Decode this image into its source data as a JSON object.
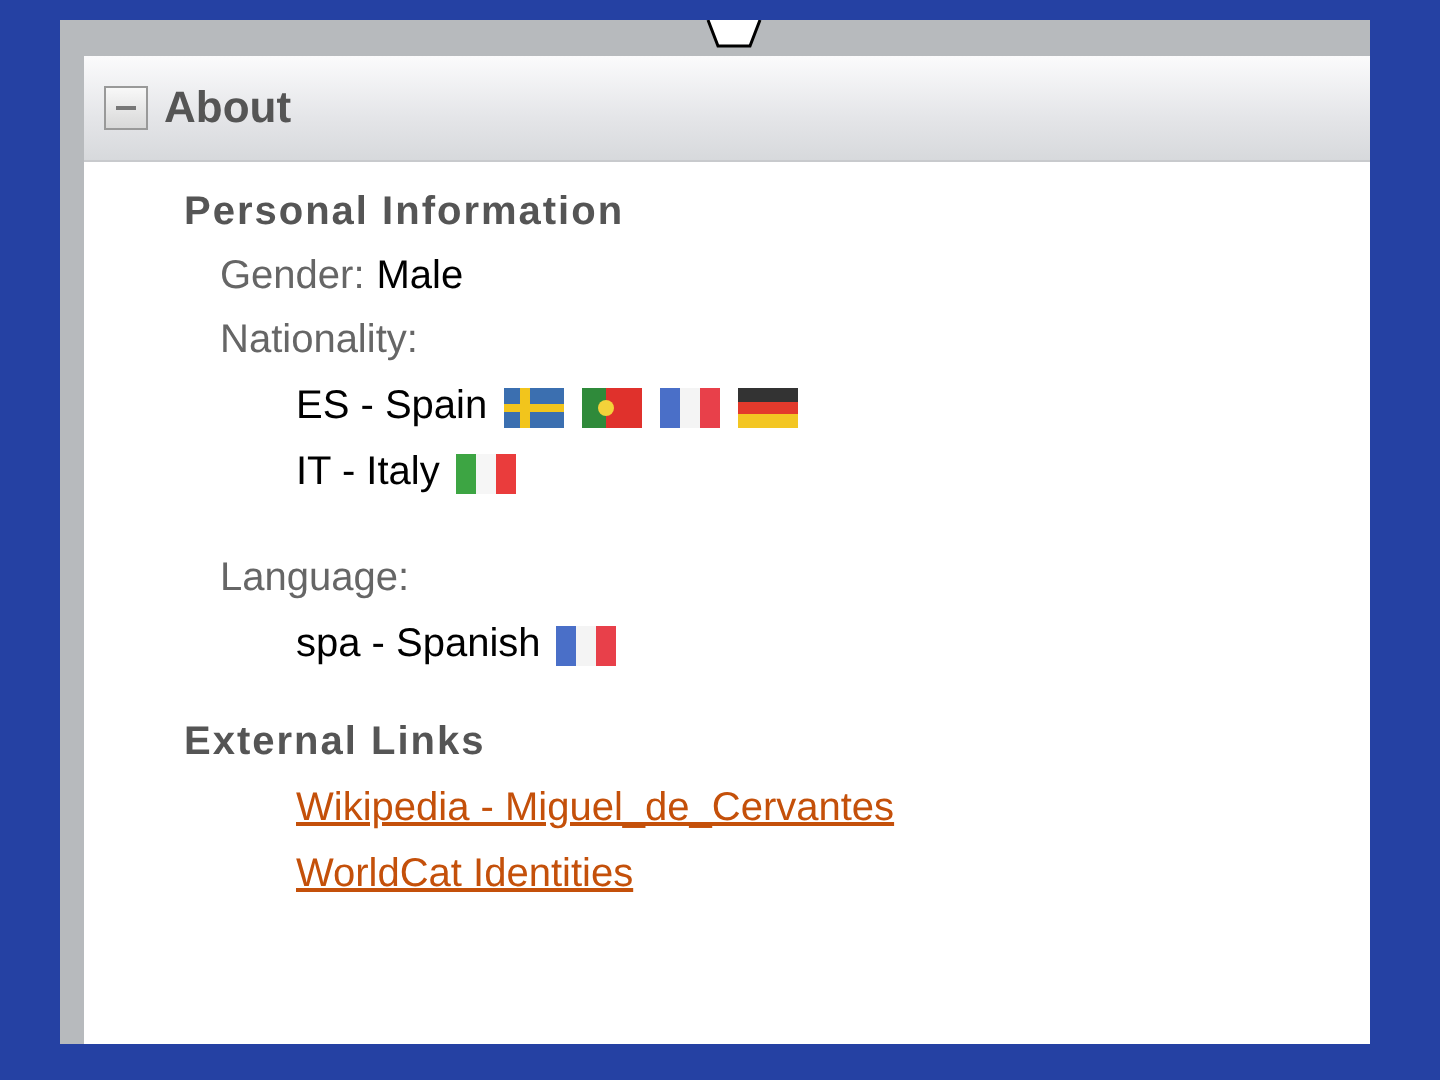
{
  "panel": {
    "title": "About",
    "expanded": true
  },
  "personal": {
    "heading": "Personal Information",
    "gender": {
      "label": "Gender:",
      "value": "Male"
    },
    "nationality": {
      "label": "Nationality:",
      "entries": [
        {
          "text": "ES - Spain",
          "flags": [
            {
              "kind": "se"
            },
            {
              "kind": "pt"
            },
            {
              "kind": "fr"
            },
            {
              "kind": "de"
            }
          ]
        },
        {
          "text": "IT - Italy",
          "flags": [
            {
              "kind": "it"
            }
          ]
        }
      ]
    },
    "language": {
      "label": "Language:",
      "entries": [
        {
          "text": "spa - Spanish",
          "flags": [
            {
              "kind": "fr"
            }
          ]
        }
      ]
    }
  },
  "external_links": {
    "heading": "External Links",
    "links": [
      "Wikipedia - Miguel_de_Cervantes",
      "WorldCat Identities"
    ]
  }
}
